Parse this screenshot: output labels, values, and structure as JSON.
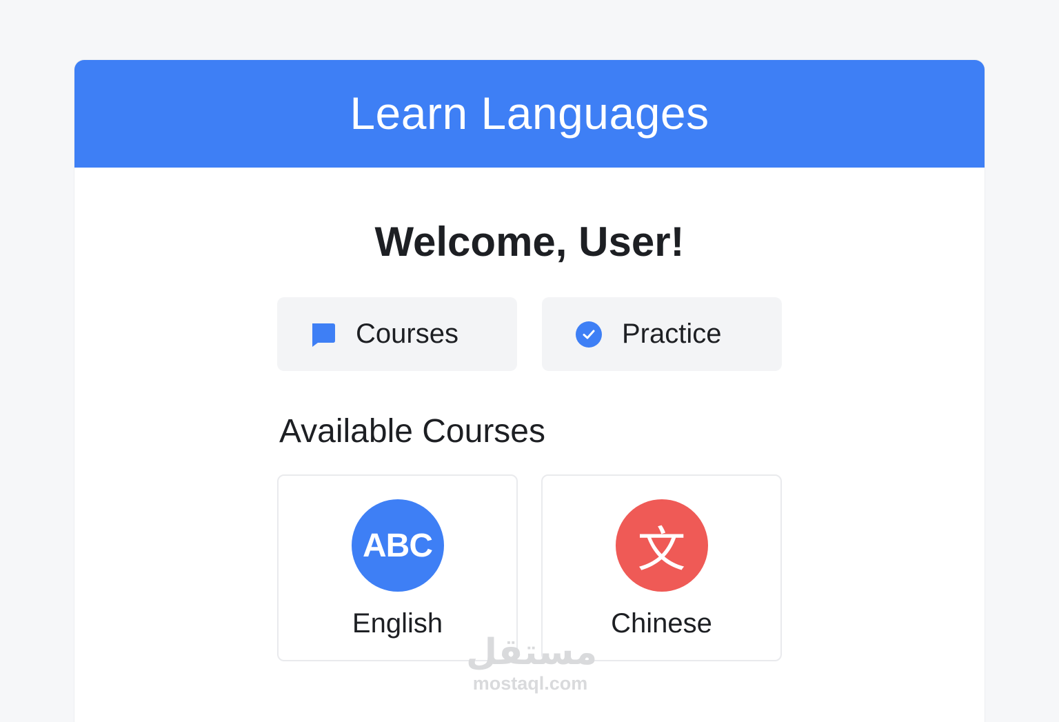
{
  "header": {
    "title": "Learn Languages"
  },
  "welcome": {
    "text": "Welcome, User!"
  },
  "actions": [
    {
      "label": "Courses",
      "icon": "chat-bubble-icon",
      "color": "#3e7ff5"
    },
    {
      "label": "Practice",
      "icon": "check-circle-icon",
      "color": "#3e7ff5"
    }
  ],
  "available_courses": {
    "title": "Available Courses",
    "items": [
      {
        "name": "English",
        "badge_text": "ABC",
        "badge_color": "#3e7ff5"
      },
      {
        "name": "Chinese",
        "badge_text": "文",
        "badge_color": "#ef5a56"
      }
    ]
  },
  "watermark": {
    "arabic": "مستقل",
    "domain": "mostaql.com"
  },
  "colors": {
    "accent": "#3e7ff5",
    "chinese": "#ef5a56",
    "background": "#f6f7f9"
  }
}
